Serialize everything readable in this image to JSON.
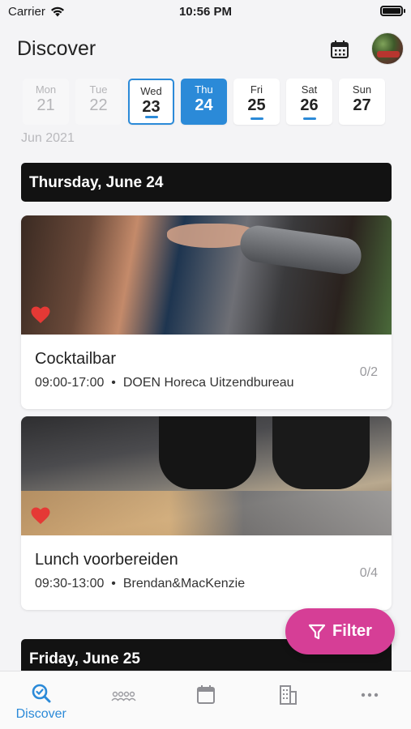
{
  "status": {
    "carrier": "Carrier",
    "time": "10:56 PM"
  },
  "header": {
    "title": "Discover"
  },
  "week": {
    "days": [
      {
        "name": "Mon",
        "date": "21"
      },
      {
        "name": "Tue",
        "date": "22"
      },
      {
        "name": "Wed",
        "date": "23"
      },
      {
        "name": "Thu",
        "date": "24"
      },
      {
        "name": "Fri",
        "date": "25"
      },
      {
        "name": "Sat",
        "date": "26"
      },
      {
        "name": "Sun",
        "date": "27"
      }
    ],
    "month": "Jun 2021"
  },
  "sections": [
    {
      "header": "Thursday, June 24",
      "cards": [
        {
          "title": "Cocktailbar",
          "time": "09:00-17:00",
          "company": "DOEN Horeca Uitzendbureau",
          "count": "0/2",
          "favorite": true
        },
        {
          "title": "Lunch voorbereiden",
          "time": "09:30-13:00",
          "company": "Brendan&MacKenzie",
          "count": "0/4",
          "favorite": true
        }
      ]
    },
    {
      "header": "Friday, June 25"
    }
  ],
  "fab": {
    "label": "Filter"
  },
  "tabbar": {
    "discover_label": "Discover"
  },
  "colors": {
    "accent": "#2b8ad8",
    "fab": "#d63e96",
    "heart": "#e53935"
  }
}
